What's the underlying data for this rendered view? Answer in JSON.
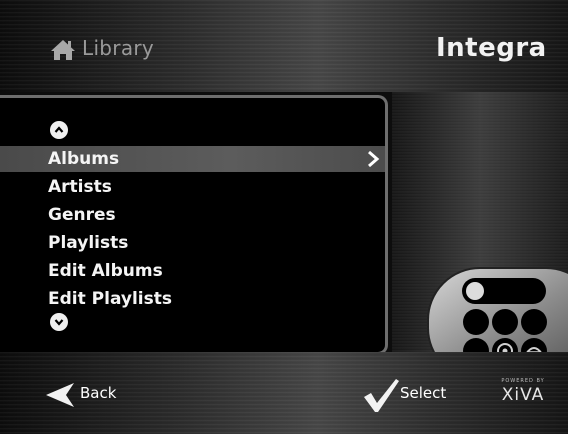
{
  "header": {
    "title": "Library",
    "brand": "Integra",
    "home_icon": "home-icon"
  },
  "menu": {
    "items": [
      {
        "label": "Albums",
        "selected": true
      },
      {
        "label": "Artists",
        "selected": false
      },
      {
        "label": "Genres",
        "selected": false
      },
      {
        "label": "Playlists",
        "selected": false
      },
      {
        "label": "Edit Albums",
        "selected": false
      },
      {
        "label": "Edit Playlists",
        "selected": false
      }
    ],
    "selected_indicator": ">",
    "scroll_up_icon": "chevron-up-icon",
    "scroll_down_icon": "chevron-down-icon"
  },
  "footer": {
    "back_label": "Back",
    "select_label": "Select",
    "powered_by": "POWERED BY",
    "platform_logo": "XiVA"
  },
  "colors": {
    "selection_bar": "#555555",
    "menu_border": "#6e6e6e",
    "text": "#f5f5f5",
    "title_text": "#9a9a9a"
  }
}
